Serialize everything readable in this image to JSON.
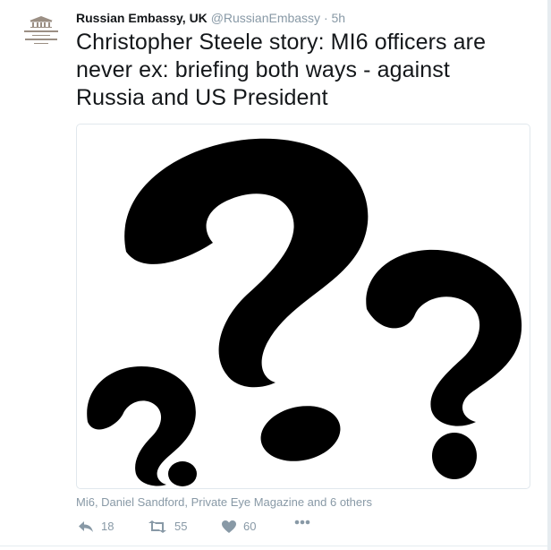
{
  "tweet": {
    "author_name": "Russian Embassy, UK",
    "handle": "@RussianEmbassy",
    "separator": "·",
    "time": "5h",
    "text": "Christopher Steele story: MI6 officers are never ex: briefing both ways - against Russia and US President",
    "context": "Mi6, Daniel Sandford, Private Eye Magazine and 6 others",
    "reply_count": "18",
    "retweet_count": "55",
    "like_count": "60"
  },
  "icons": {
    "reply": "reply-icon",
    "retweet": "retweet-icon",
    "like": "heart-icon",
    "more": "more-icon",
    "avatar": "embassy-logo"
  },
  "colors": {
    "text": "#14171a",
    "secondary": "#8899a6",
    "border": "#e1e8ed",
    "logo": "#9b8f84"
  }
}
